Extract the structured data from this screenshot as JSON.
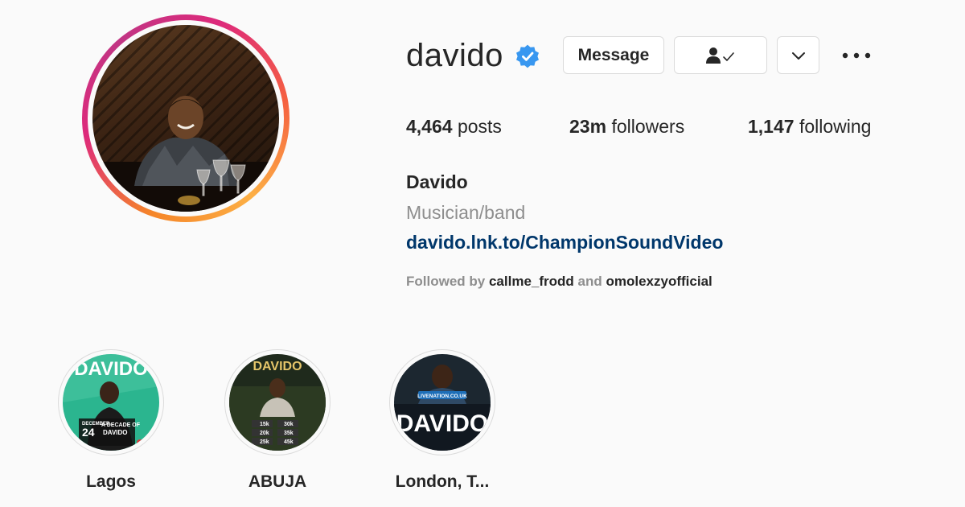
{
  "profile": {
    "username": "davido",
    "verified": true,
    "full_name": "Davido",
    "category": "Musician/band",
    "link": "davido.lnk.to/ChampionSoundVideo",
    "followed_by_prefix": "Followed by",
    "followed_by_1": "callme_frodd",
    "followed_by_and": "and",
    "followed_by_2": "omolexzyofficial"
  },
  "actions": {
    "message_label": "Message",
    "following_icon": "person-check-icon",
    "suggest_icon": "chevron-down-icon",
    "more_icon": "more-horizontal-icon"
  },
  "stats": {
    "posts_count": "4,464",
    "posts_label": "posts",
    "followers_count": "23m",
    "followers_label": "followers",
    "following_count": "1,147",
    "following_label": "following"
  },
  "highlights": [
    {
      "label": "Lagos",
      "cover_texts": [
        "DAVIDO",
        "DECEMBER",
        "24",
        "A DECADE OF",
        "DAVIDO"
      ]
    },
    {
      "label": "ABUJA",
      "cover_texts": [
        "DAVIDO",
        "15k",
        "30k",
        "20k",
        "35k",
        "25k",
        "45k"
      ]
    },
    {
      "label": "London, T...",
      "cover_texts": [
        "LIVENATION.CO.UK",
        "DAVIDO"
      ]
    }
  ],
  "colors": {
    "verified_badge": "#3897f0",
    "link": "#00376b",
    "muted": "#8e8e8e",
    "text": "#262626",
    "lagos_teal": "#2bb58f"
  }
}
